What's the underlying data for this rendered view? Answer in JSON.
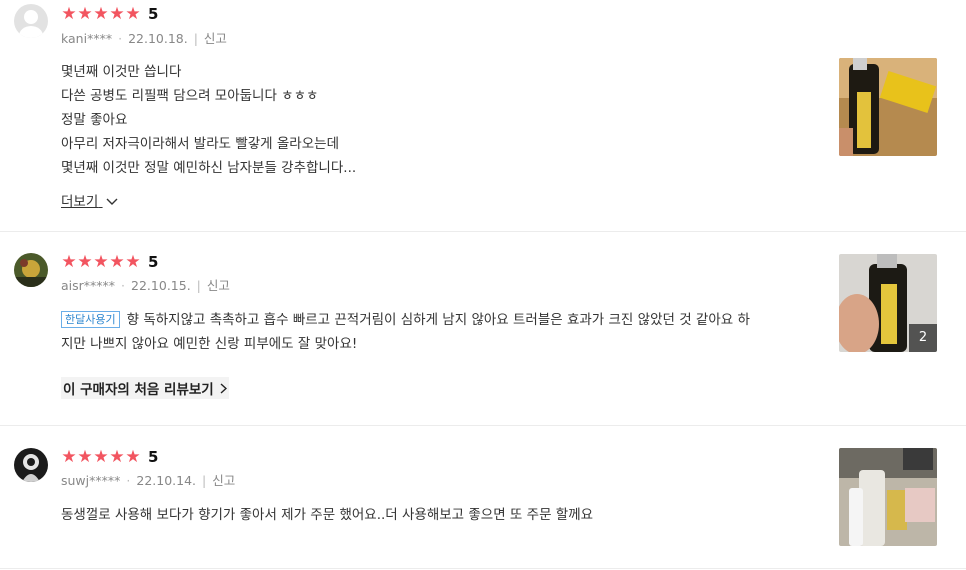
{
  "reviews": [
    {
      "rating_stars": 5,
      "score": "5",
      "user": "kani****",
      "date": "22.10.18.",
      "report": "신고",
      "lines": [
        "몇년째 이것만 씁니다",
        "다쓴 공병도 리필팩 담으려 모아둡니다 ㅎㅎㅎ",
        "정말 좋아요",
        "아무리 저자극이라해서 발라도 빨갛게 올라오는데",
        "몇년째 이것만 정말 예민하신 남자분들 강추합니다..."
      ],
      "more_label": "더보기"
    },
    {
      "rating_stars": 5,
      "score": "5",
      "user": "aisr*****",
      "date": "22.10.15.",
      "report": "신고",
      "badge": "한달사용기",
      "line1": "향 독하지않고 촉촉하고 흡수 빠르고 끈적거림이 심하게 남지 않아요 트러블은 효과가 크진 않았던 것 같아요 하",
      "line2": "지만 나쁘지 않아요 예민한 신랑 피부에도 잘 맞아요!",
      "first_review_label": "이 구매자의 처음 리뷰보기",
      "photo_count": "2"
    },
    {
      "rating_stars": 5,
      "score": "5",
      "user": "suwj*****",
      "date": "22.10.14.",
      "report": "신고",
      "text": "동생껄로 사용해 보다가 향기가 좋아서 제가 주문 했어요..더 사용해보고 좋으면 또 주문 할께요"
    }
  ],
  "colors": {
    "star": "#f25560",
    "badge_blue": "#2f88d0"
  },
  "icons": {
    "star": "star-icon",
    "chevron": "chevron-down-icon",
    "chevron_right": "chevron-right-icon"
  }
}
